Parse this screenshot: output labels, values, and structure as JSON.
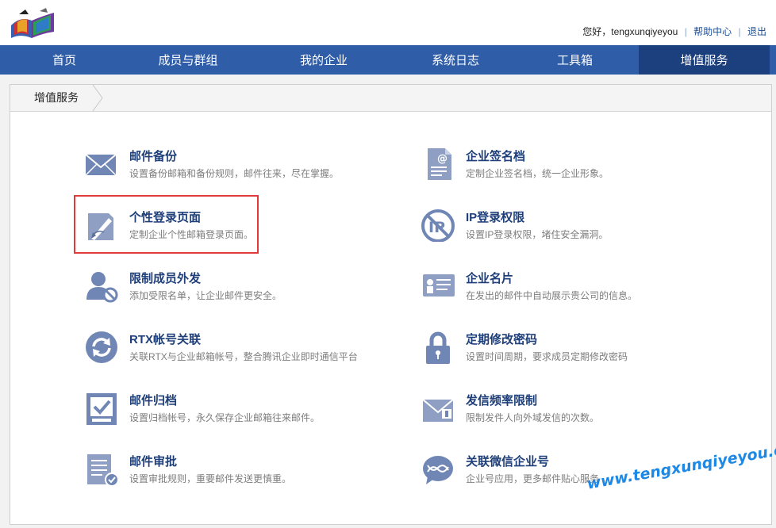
{
  "header": {
    "greeting": "您好，tengxunqiyeyou",
    "help_link": "帮助中心",
    "logout_link": "退出"
  },
  "nav": {
    "items": [
      {
        "label": "首页"
      },
      {
        "label": "成员与群组"
      },
      {
        "label": "我的企业"
      },
      {
        "label": "系统日志"
      },
      {
        "label": "工具箱"
      },
      {
        "label": "增值服务"
      }
    ],
    "active_index": 5
  },
  "breadcrumb": {
    "label": "增值服务"
  },
  "features": [
    {
      "title": "邮件备份",
      "desc": "设置备份邮箱和备份规则，邮件往来，尽在掌握。",
      "icon": "mail-envelope-icon"
    },
    {
      "title": "企业签名档",
      "desc": "定制企业签名档，统一企业形象。",
      "icon": "signature-document-icon"
    },
    {
      "title": "个性登录页面",
      "desc": "定制企业个性邮箱登录页面。",
      "icon": "edit-page-icon"
    },
    {
      "title": "IP登录权限",
      "desc": "设置IP登录权限，堵住安全漏洞。",
      "icon": "ip-prohibited-icon"
    },
    {
      "title": "限制成员外发",
      "desc": "添加受限名单，让企业邮件更安全。",
      "icon": "user-blocked-icon"
    },
    {
      "title": "企业名片",
      "desc": "在发出的邮件中自动展示贵公司的信息。",
      "icon": "business-card-icon"
    },
    {
      "title": "RTX帐号关联",
      "desc": "关联RTX与企业邮箱帐号，整合腾讯企业即时通信平台",
      "icon": "sync-icon"
    },
    {
      "title": "定期修改密码",
      "desc": "设置时间周期，要求成员定期修改密码",
      "icon": "padlock-icon"
    },
    {
      "title": "邮件归档",
      "desc": "设置归档帐号，永久保存企业邮箱往来邮件。",
      "icon": "archive-check-icon"
    },
    {
      "title": "发信频率限制",
      "desc": "限制发件人向外域发信的次数。",
      "icon": "mail-rate-limit-icon"
    },
    {
      "title": "邮件审批",
      "desc": "设置审批规则，重要邮件发送更慎重。",
      "icon": "approval-document-icon"
    },
    {
      "title": "关联微信企业号",
      "desc": "企业号应用，更多邮件贴心服务",
      "icon": "wechat-chat-icon"
    }
  ],
  "watermark": "www.tengxunqiyeyou.com",
  "colors": {
    "nav_bg": "#2f5da8",
    "nav_active": "#1c3f7e",
    "title_text": "#1e3f7a",
    "icon_fill": "#7087b5",
    "highlight": "#e03a3a",
    "watermark": "#1e88e5"
  }
}
